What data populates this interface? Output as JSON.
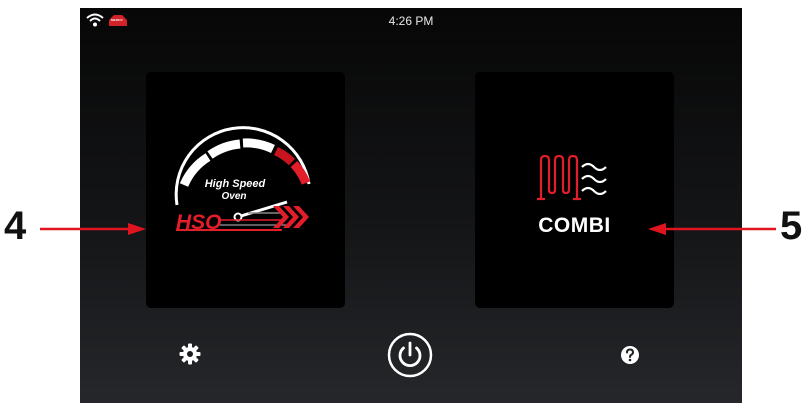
{
  "status_bar": {
    "time": "4:26 PM",
    "icons": [
      "wifi-icon",
      "brand-badge-icon"
    ],
    "brand_badge_text": "MERCO"
  },
  "modes": {
    "hso": {
      "gauge_line1": "High Speed",
      "gauge_line2": "Oven",
      "label": "HSO",
      "icon": "speedometer-icon"
    },
    "combi": {
      "label": "COMBI",
      "icon": "heating-element-steam-icon"
    }
  },
  "bottom_bar": {
    "settings_icon": "gear-icon",
    "power_icon": "power-icon",
    "help_icon": "question-mark-icon"
  },
  "callouts": {
    "left": "4",
    "right": "5"
  },
  "colors": {
    "accent_red": "#e41d2b",
    "tile_bg": "#000000",
    "text_white": "#ffffff"
  }
}
